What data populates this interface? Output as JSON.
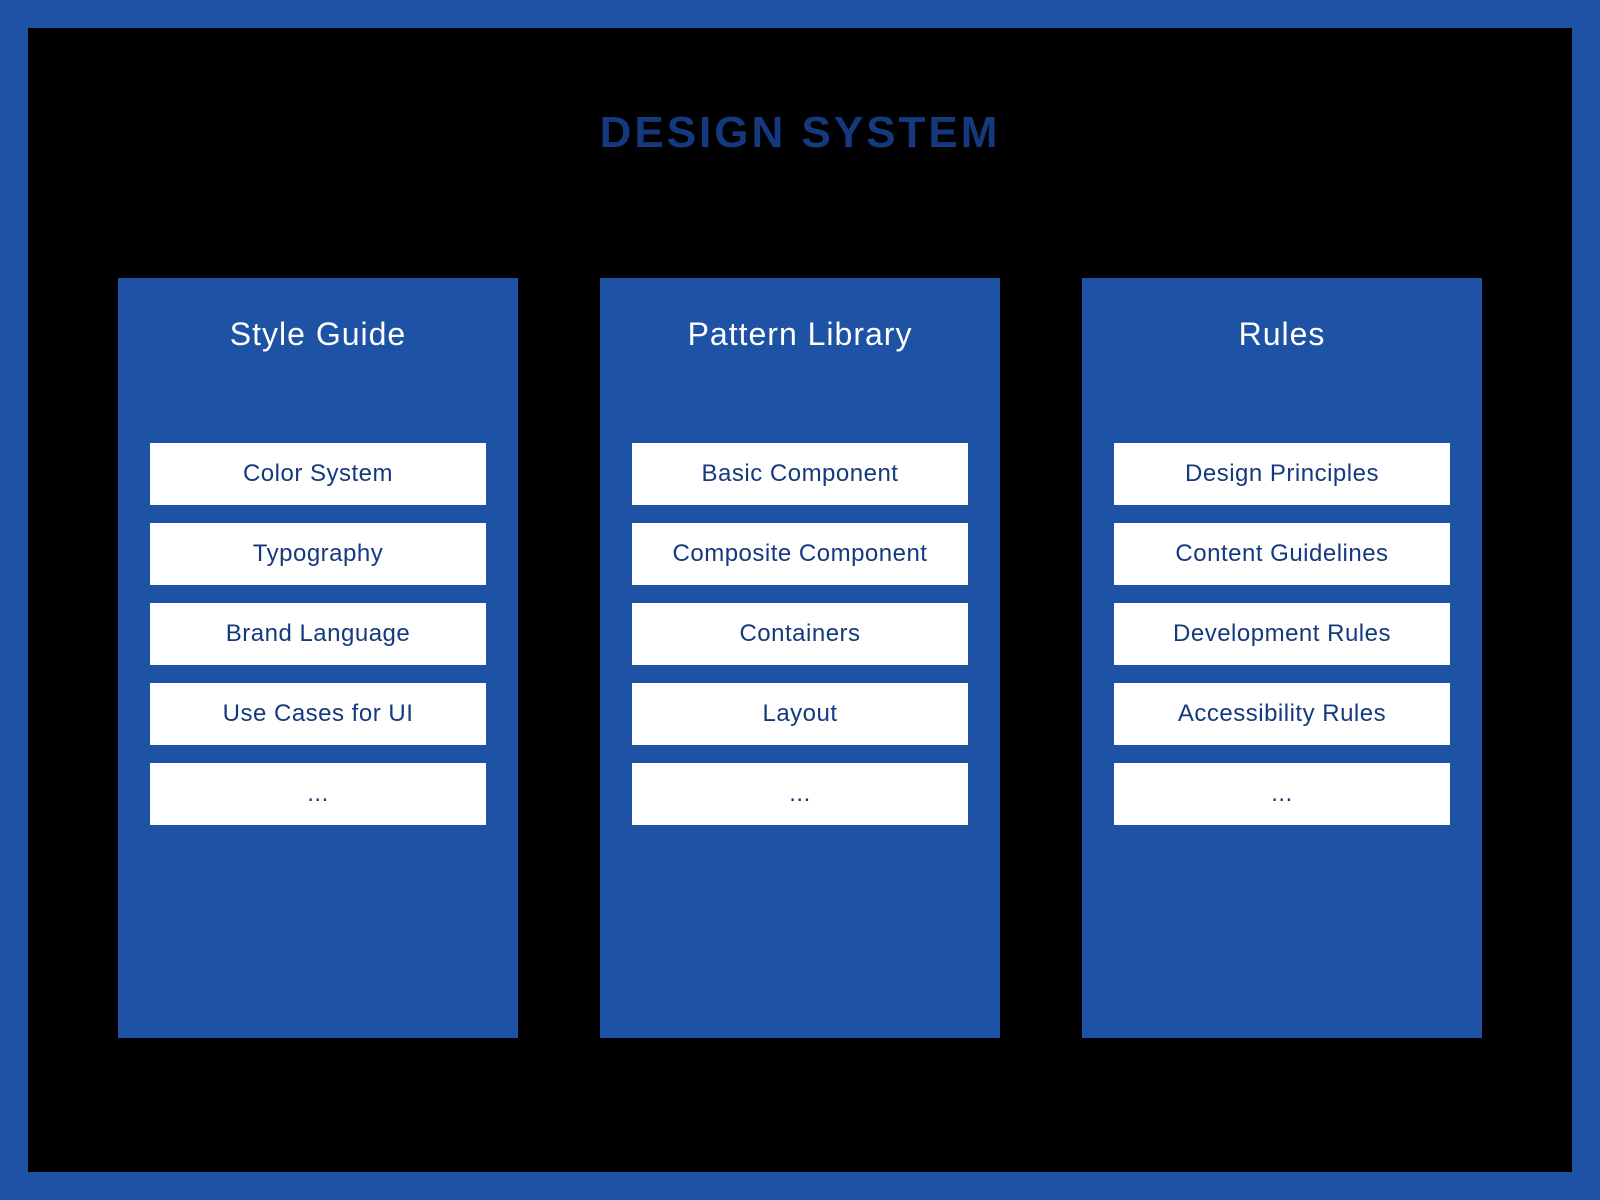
{
  "title": "DESIGN SYSTEM",
  "columns": [
    {
      "title": "Style Guide",
      "items": [
        "Color System",
        "Typography",
        "Brand Language",
        "Use Cases for UI",
        "..."
      ]
    },
    {
      "title": "Pattern Library",
      "items": [
        "Basic Component",
        "Composite Component",
        "Containers",
        "Layout",
        "..."
      ]
    },
    {
      "title": "Rules",
      "items": [
        "Design Principles",
        "Content Guidelines",
        "Development Rules",
        "Accessibility Rules",
        "..."
      ]
    }
  ]
}
